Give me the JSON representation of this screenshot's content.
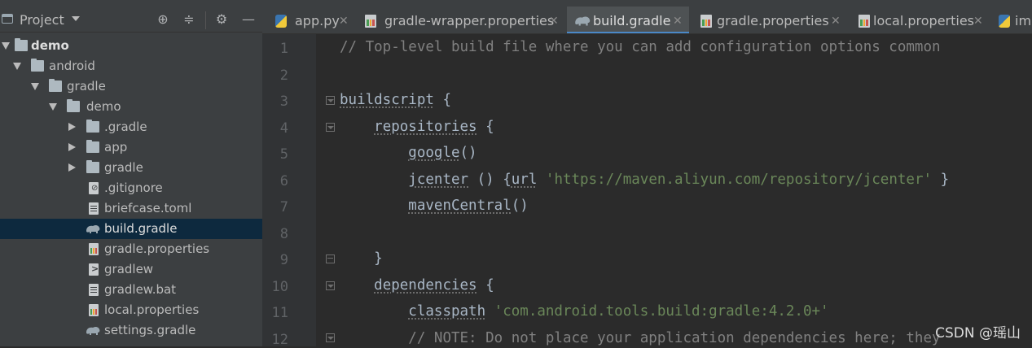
{
  "project_panel": {
    "title": "Project",
    "tree": [
      {
        "label": "demo",
        "bold": true
      },
      {
        "label": "android"
      },
      {
        "label": "gradle"
      },
      {
        "label": "demo"
      },
      {
        "label": ".gradle"
      },
      {
        "label": "app"
      },
      {
        "label": "gradle"
      },
      {
        "label": ".gitignore"
      },
      {
        "label": "briefcase.toml"
      },
      {
        "label": "build.gradle"
      },
      {
        "label": "gradle.properties"
      },
      {
        "label": "gradlew"
      },
      {
        "label": "gradlew.bat"
      },
      {
        "label": "local.properties"
      },
      {
        "label": "settings.gradle"
      }
    ]
  },
  "tabs": [
    {
      "label": "app.py"
    },
    {
      "label": "gradle-wrapper.properties"
    },
    {
      "label": "build.gradle"
    },
    {
      "label": "gradle.properties"
    },
    {
      "label": "local.properties"
    },
    {
      "label": "im"
    }
  ],
  "editor": {
    "line_numbers": [
      "1",
      "2",
      "3",
      "4",
      "5",
      "6",
      "7",
      "8",
      "9",
      "10",
      "11",
      "12"
    ],
    "lines": {
      "l1": "// Top-level build file where you can add configuration options common",
      "l3_kw": "buildscript",
      "l4_kw": "repositories",
      "l5_kw": "google",
      "l6_kw": "jcenter",
      "l6_kw2": "url",
      "l6_str": "'https://maven.aliyun.com/repository/jcenter'",
      "l7_kw": "mavenCentral",
      "l10_kw": "dependencies",
      "l11_kw": "classpath",
      "l11_str": "'com.android.tools.build:gradle:4.2.0+'",
      "l12": "// NOTE: Do not place your application dependencies here; they"
    }
  },
  "watermark": "CSDN @瑶山"
}
